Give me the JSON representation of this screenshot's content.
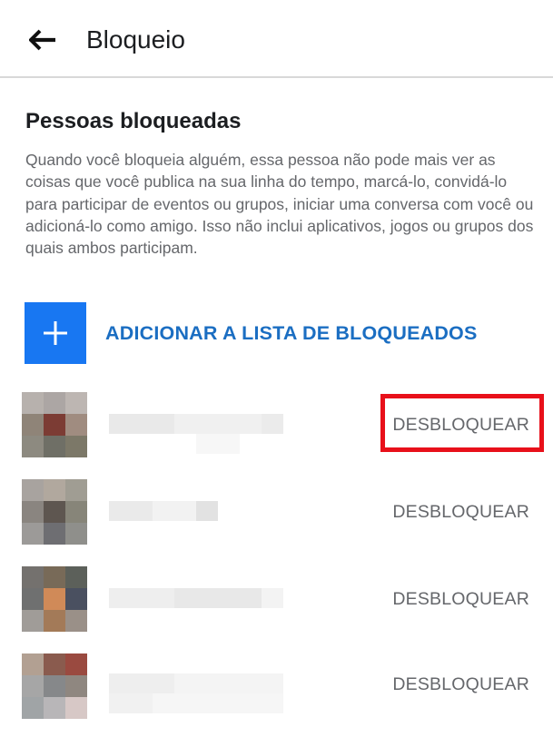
{
  "header": {
    "title": "Bloqueio",
    "back_icon": "arrow-left-icon"
  },
  "section": {
    "title": "Pessoas bloqueadas",
    "description": "Quando você bloqueia alguém, essa pessoa não pode mais ver as coisas que você publica na sua linha do tempo, marcá-lo, convidá-lo para participar de eventos ou grupos, iniciar uma conversa com você ou adicioná-lo como amigo. Isso não inclui aplicativos, jogos ou grupos dos quais ambos participam."
  },
  "add_button": {
    "label": "ADICIONAR A LISTA DE BLOQUEADOS",
    "icon": "plus-icon",
    "color": "#1877f2"
  },
  "blocked_list": [
    {
      "action_label": "DESBLOQUEAR",
      "highlighted": true,
      "avatar_colors": [
        "#b7b1ad",
        "#aca6a4",
        "#bdb6b2",
        "#8f8478",
        "#7c3c34",
        "#a08c80",
        "#8d8a80",
        "#6f6f66",
        "#7c7868"
      ]
    },
    {
      "action_label": "DESBLOQUEAR",
      "highlighted": false,
      "avatar_colors": [
        "#a8a39f",
        "#b1a89e",
        "#a09d93",
        "#8a8580",
        "#5e5650",
        "#878579",
        "#9c9a98",
        "#6e6e72",
        "#8f8f8b"
      ]
    },
    {
      "action_label": "DESBLOQUEAR",
      "highlighted": false,
      "avatar_colors": [
        "#74716e",
        "#786a58",
        "#5c605a",
        "#6f7070",
        "#d08a58",
        "#4a5060",
        "#a09c98",
        "#a37a58",
        "#9a9088"
      ]
    },
    {
      "action_label": "DESBLOQUEAR",
      "highlighted": false,
      "avatar_colors": [
        "#b2a092",
        "#8a5b4e",
        "#9a4a40",
        "#a6a6a6",
        "#86888a",
        "#8f8780",
        "#a0a4a6",
        "#b8b6b8",
        "#d7c8c6"
      ]
    }
  ],
  "colors": {
    "highlight_border": "#e8101a",
    "link_blue": "#1b6ec2",
    "secondary_text": "#65676b"
  }
}
